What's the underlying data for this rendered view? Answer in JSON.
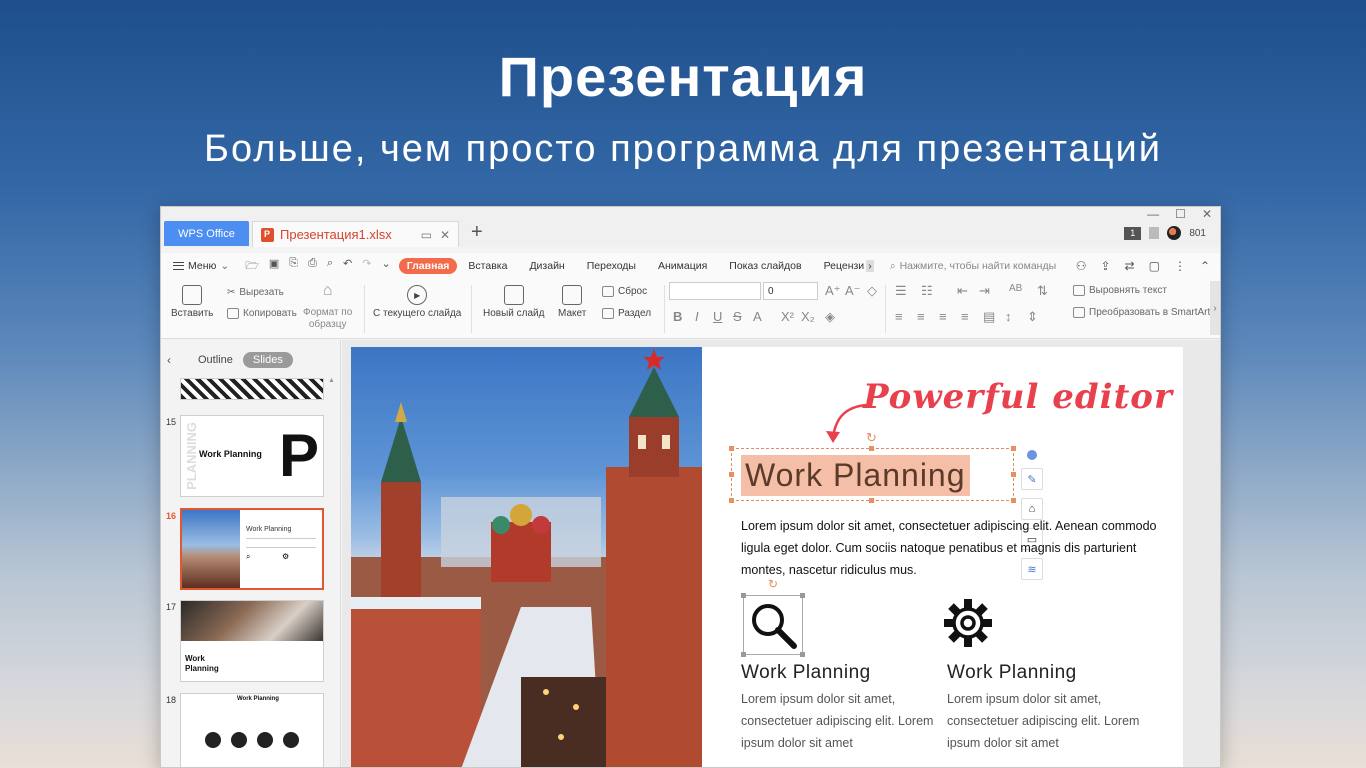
{
  "hero": {
    "title": "Презентация",
    "subtitle": "Больше, чем просто программа для презентаций"
  },
  "tabbar": {
    "app_tab": "WPS Office",
    "doc_tab": "Презентация1.xlsx",
    "user_count": "801",
    "badge": "1"
  },
  "menu": {
    "menu_label": "Меню",
    "tabs": [
      "Главная",
      "Вставка",
      "Дизайн",
      "Переходы",
      "Анимация",
      "Показ слайдов",
      "Рецензи"
    ],
    "search_placeholder": "Нажмите, чтобы найти команды"
  },
  "toolbar": {
    "paste": "Вставить",
    "cut": "Вырезать",
    "copy": "Копировать",
    "format_painter_1": "Формат по",
    "format_painter_2": "образцу",
    "from_current": "С текущего слайда",
    "new_slide": "Новый слайд",
    "layout": "Макет",
    "reset": "Сброс",
    "section": "Раздел",
    "font_size": "0",
    "align_text": "Выровнять текст",
    "smartart": "Преобразовать в SmartArt"
  },
  "left_panel": {
    "outline_tab": "Outline",
    "slides_tab": "Slides",
    "slides": [
      {
        "num": "15",
        "title": "Work Planning",
        "side_text": "PLANNING",
        "big_letter": "P"
      },
      {
        "num": "16",
        "title": "Work Planning",
        "selected": true
      },
      {
        "num": "17",
        "title": "Work Planning"
      },
      {
        "num": "18",
        "title": "Work Planning"
      }
    ]
  },
  "slide": {
    "callout": "Powerful editor",
    "title": "Work  Planning",
    "body": "Lorem ipsum dolor sit amet, consectetuer adipiscing elit. Aenean commodo ligula eget dolor. Cum sociis natoque penatibus et magnis dis parturient montes, nascetur ridiculus mus.",
    "features": [
      {
        "icon": "search-icon",
        "title": "Work  Planning",
        "text": "Lorem ipsum dolor sit amet, consectetuer adipiscing elit. Lorem ipsum dolor sit amet"
      },
      {
        "icon": "gear-icon",
        "title": "Work  Planning",
        "text": "Lorem ipsum dolor sit amet, consectetuer adipiscing elit. Lorem ipsum dolor sit amet"
      }
    ]
  },
  "colors": {
    "accent": "#f26b4a",
    "callout": "#e8404c",
    "wps_blue": "#4d8ef2"
  }
}
